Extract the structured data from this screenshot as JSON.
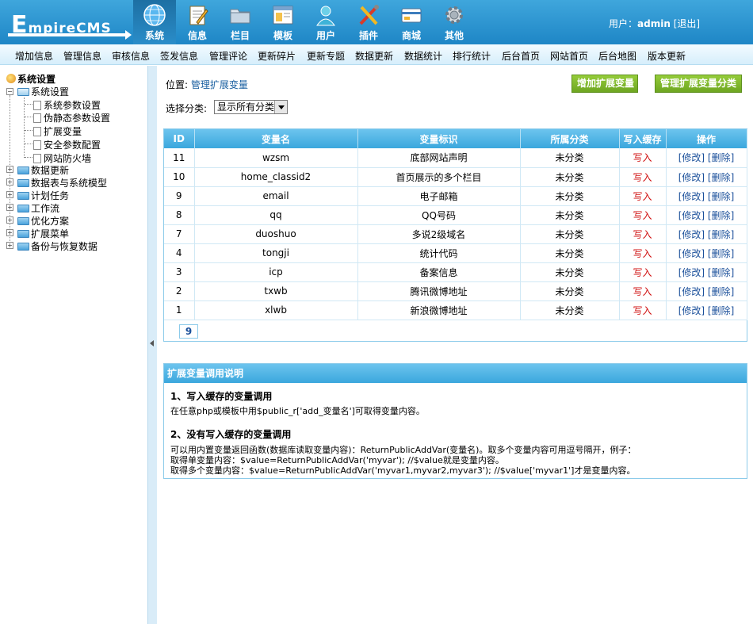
{
  "header": {
    "logo": "EmpireCMS",
    "logo_first": "E",
    "logo_rest": "mpireCMS",
    "tabs": [
      {
        "label": "系统",
        "icon": "globe-icon",
        "active": true
      },
      {
        "label": "信息",
        "icon": "document-edit-icon",
        "active": false
      },
      {
        "label": "栏目",
        "icon": "folder-icon",
        "active": false
      },
      {
        "label": "模板",
        "icon": "window-template-icon",
        "active": false
      },
      {
        "label": "用户",
        "icon": "user-icon",
        "active": false
      },
      {
        "label": "插件",
        "icon": "tools-icon",
        "active": false
      },
      {
        "label": "商城",
        "icon": "card-shop-icon",
        "active": false
      },
      {
        "label": "其他",
        "icon": "gear-icon",
        "active": false
      }
    ],
    "user_label": "用户：",
    "username": "admin",
    "logout": "[退出]"
  },
  "submenu": [
    "增加信息",
    "管理信息",
    "审核信息",
    "签发信息",
    "管理评论",
    "更新碎片",
    "更新专题",
    "数据更新",
    "数据统计",
    "排行统计",
    "后台首页",
    "网站首页",
    "后台地图",
    "版本更新"
  ],
  "sidebar": {
    "root": "系统设置",
    "open_group": "系统设置",
    "open_children": [
      "系统参数设置",
      "伪静态参数设置",
      "扩展变量",
      "安全参数配置",
      "网站防火墙"
    ],
    "groups": [
      "数据更新",
      "数据表与系统模型",
      "计划任务",
      "工作流",
      "优化方案",
      "扩展菜单",
      "备份与恢复数据"
    ]
  },
  "main": {
    "location_label": "位置: ",
    "location_link": "管理扩展变量",
    "add_button": "增加扩展变量",
    "manage_class_button": "管理扩展变量分类",
    "filter_label": "选择分类:",
    "filter_value": "显示所有分类",
    "table": {
      "headers": [
        "ID",
        "变量名",
        "变量标识",
        "所属分类",
        "写入缓存",
        "操作"
      ],
      "rows": [
        [
          "11",
          "wzsm",
          "底部网站声明",
          "未分类",
          "写入",
          "[修改] [删除]"
        ],
        [
          "10",
          "home_classid2",
          "首页展示的多个栏目",
          "未分类",
          "写入",
          "[修改] [删除]"
        ],
        [
          "9",
          "email",
          "电子邮箱",
          "未分类",
          "写入",
          "[修改] [删除]"
        ],
        [
          "8",
          "qq",
          "QQ号码",
          "未分类",
          "写入",
          "[修改] [删除]"
        ],
        [
          "7",
          "duoshuo",
          "多说2级域名",
          "未分类",
          "写入",
          "[修改] [删除]"
        ],
        [
          "4",
          "tongji",
          "统计代码",
          "未分类",
          "写入",
          "[修改] [删除]"
        ],
        [
          "3",
          "icp",
          "备案信息",
          "未分类",
          "写入",
          "[修改] [删除]"
        ],
        [
          "2",
          "txwb",
          "腾讯微博地址",
          "未分类",
          "写入",
          "[修改] [删除]"
        ],
        [
          "1",
          "xlwb",
          "新浪微博地址",
          "未分类",
          "写入",
          "[修改] [删除]"
        ]
      ],
      "pager": "9"
    },
    "notes": {
      "title": "扩展变量调用说明",
      "h1": "1、写入缓存的变量调用",
      "p1": "在任意php或模板中用$public_r['add_变量名']可取得变量内容。",
      "h2": "2、没有写入缓存的变量调用",
      "p2": "可以用内置变量返回函数(数据库读取变量内容)：ReturnPublicAddVar(变量名)。取多个变量内容可用逗号隔开，例子：",
      "p3": "取得单变量内容：$value=ReturnPublicAddVar('myvar'); //$value就是变量内容。",
      "p4": "取得多个变量内容：$value=ReturnPublicAddVar('myvar1,myvar2,myvar3'); //$value['myvar1']才是变量内容。"
    }
  }
}
